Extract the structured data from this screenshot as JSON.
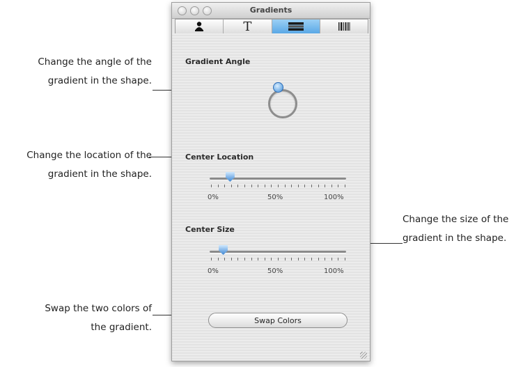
{
  "window": {
    "title": "Gradients",
    "toolbar": [
      {
        "name": "person-icon"
      },
      {
        "name": "text-icon",
        "glyph": "T"
      },
      {
        "name": "gradient-icon",
        "selected": true
      },
      {
        "name": "barcode-icon"
      }
    ]
  },
  "gradient_angle": {
    "label": "Gradient Angle"
  },
  "center_location": {
    "label": "Center Location",
    "value_fraction": 0.15,
    "ticks": [
      "0%",
      "50%",
      "100%"
    ]
  },
  "center_size": {
    "label": "Center Size",
    "value_fraction": 0.1,
    "ticks": [
      "0%",
      "50%",
      "100%"
    ]
  },
  "swap_button": {
    "label": "Swap Colors"
  },
  "callouts": {
    "angle": {
      "line1": "Change the angle of the",
      "line2": "gradient in the shape."
    },
    "location": {
      "line1": "Change the location of the",
      "line2": "gradient in the shape."
    },
    "size": {
      "line1": "Change the size of the",
      "line2": "gradient in the shape."
    },
    "swap": {
      "line1": "Swap the two colors of",
      "line2": "the gradient."
    }
  }
}
